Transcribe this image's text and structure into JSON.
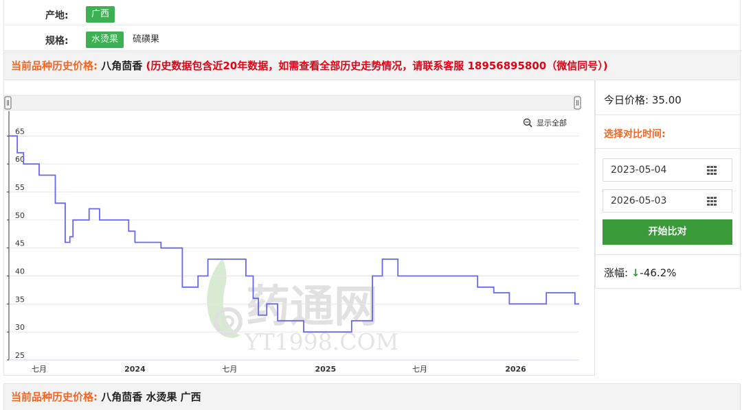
{
  "filters": {
    "origin_label": "产地:",
    "origin_value": "广西",
    "spec_label": "规格:",
    "spec_selected": "水烫果",
    "spec_other": "硫磺果"
  },
  "banner": {
    "prefix": "当前品种历史价格:",
    "name": "八角茴香",
    "note": "(历史数据包含近20年数据，如需查看全部历史走势情况，请联系客服 18956895800（微信同号）)"
  },
  "chart_toolbar": {
    "show_all": "显示全部"
  },
  "watermark": {
    "brand": "药通网",
    "site": "YT1998.COM"
  },
  "side": {
    "today_price_label": "今日价格:",
    "today_price_value": "35.00",
    "compare_title": "选择对比时间:",
    "date_start": "2023-05-04",
    "date_end": "2026-05-03",
    "start_button": "开始比对",
    "change_label": "涨幅:",
    "change_arrow": "↓",
    "change_value": "-46.2%"
  },
  "bottom_banner": {
    "prefix": "当前品种历史价格:",
    "name": "八角茴香 水烫果 广西"
  },
  "colors": {
    "line": "#6666ee",
    "tag_green": "#3bb154",
    "button_green": "#3a9a3a",
    "orange": "#f26522",
    "red": "#e60012"
  },
  "chart_data": {
    "type": "line",
    "step": true,
    "x_range": [
      "2023-05-04",
      "2026-05-03"
    ],
    "ylim": [
      25,
      67
    ],
    "y_ticks": [
      25,
      30,
      35,
      40,
      45,
      50,
      55,
      60,
      65
    ],
    "x_ticks": [
      {
        "date": "2023-07-01",
        "label": "七月",
        "bold": false
      },
      {
        "date": "2024-01-01",
        "label": "2024",
        "bold": true
      },
      {
        "date": "2024-07-01",
        "label": "七月",
        "bold": false
      },
      {
        "date": "2025-01-01",
        "label": "2025",
        "bold": true
      },
      {
        "date": "2025-07-01",
        "label": "七月",
        "bold": false
      },
      {
        "date": "2026-01-01",
        "label": "2026",
        "bold": true
      }
    ],
    "grid": true,
    "series": [
      {
        "points": [
          [
            "2023-05-04",
            65
          ],
          [
            "2023-05-20",
            62
          ],
          [
            "2023-06-01",
            60
          ],
          [
            "2023-07-01",
            58
          ],
          [
            "2023-08-01",
            53
          ],
          [
            "2023-08-20",
            46
          ],
          [
            "2023-08-29",
            47
          ],
          [
            "2023-09-04",
            50
          ],
          [
            "2023-10-05",
            52
          ],
          [
            "2023-10-25",
            50
          ],
          [
            "2023-12-20",
            48
          ],
          [
            "2024-01-01",
            46
          ],
          [
            "2024-02-20",
            45
          ],
          [
            "2024-04-01",
            38
          ],
          [
            "2024-05-01",
            40
          ],
          [
            "2024-05-20",
            43
          ],
          [
            "2024-08-01",
            40
          ],
          [
            "2024-08-15",
            36
          ],
          [
            "2024-08-25",
            33
          ],
          [
            "2024-09-10",
            35
          ],
          [
            "2024-10-01",
            32
          ],
          [
            "2024-11-20",
            30
          ],
          [
            "2025-02-20",
            32
          ],
          [
            "2025-04-01",
            40
          ],
          [
            "2025-04-20",
            43
          ],
          [
            "2025-05-20",
            40
          ],
          [
            "2025-10-20",
            38
          ],
          [
            "2025-11-20",
            37
          ],
          [
            "2025-12-20",
            35
          ],
          [
            "2026-03-01",
            37
          ],
          [
            "2026-04-25",
            35
          ],
          [
            "2026-05-03",
            35
          ]
        ]
      }
    ]
  }
}
